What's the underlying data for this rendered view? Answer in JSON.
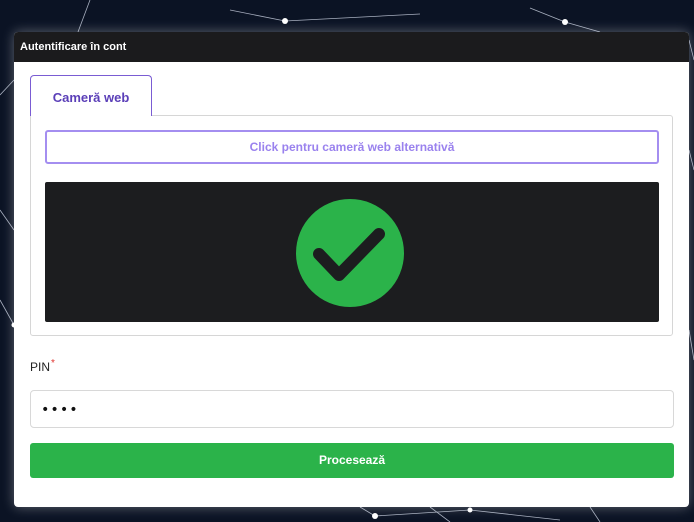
{
  "modal": {
    "title": "Autentificare în cont"
  },
  "tabs": [
    {
      "label": "Cameră web",
      "active": true
    }
  ],
  "webcam": {
    "alt_button_label": "Click pentru cameră web alternativă",
    "status_icon": "check-circle-icon",
    "status_color": "#2bb34a"
  },
  "pin": {
    "label": "PIN",
    "required_mark": "*",
    "value": "••••"
  },
  "submit": {
    "label": "Procesează"
  },
  "colors": {
    "accent": "#7a5cd3",
    "success": "#2bb34a",
    "header_bg": "#1b1b1d",
    "page_bg": "#0b1324"
  }
}
